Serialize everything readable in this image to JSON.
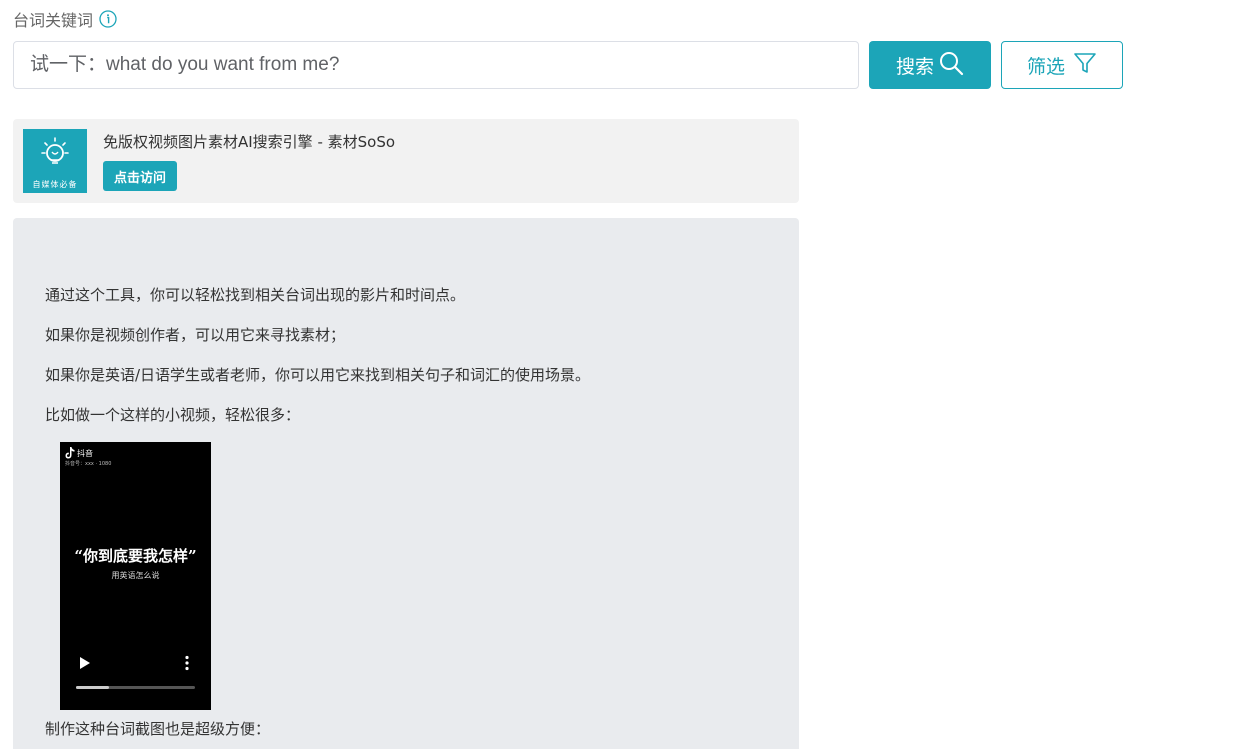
{
  "header": {
    "label": "台词关键词",
    "info_icon": "info-circle-icon"
  },
  "search": {
    "placeholder": "试一下：what do you want from me?",
    "search_button_label": "搜索",
    "search_icon": "search-icon",
    "filter_button_label": "筛选",
    "filter_icon": "funnel-icon"
  },
  "ad": {
    "logo_icon": "lightbulb-icon",
    "logo_caption": "自媒体必备",
    "title": "免版权视频图片素材AI搜索引擎 - 素材SoSo",
    "visit_label": "点击访问"
  },
  "intro": {
    "paragraphs": [
      "通过这个工具，你可以轻松找到相关台词出现的影片和时间点。",
      "如果你是视频创作者，可以用它来寻找素材；",
      "如果你是英语/日语学生或者老师，你可以用它来找到相关句子和词汇的使用场景。",
      "比如做一个这样的小视频，轻松很多："
    ],
    "video": {
      "app_name": "抖音",
      "account_line": "抖音号：xxx · 1080",
      "caption": "“你到底要我怎样”",
      "subcaption": "用英语怎么说",
      "progress": 0.28,
      "play_icon": "play-icon",
      "more_icon": "more-vertical-icon"
    },
    "footer_text": "制作这种台词截图也是超级方便："
  },
  "colors": {
    "accent": "#1ca5b8",
    "card_bg": "#f2f2f2",
    "intro_bg": "#e9ebee"
  }
}
